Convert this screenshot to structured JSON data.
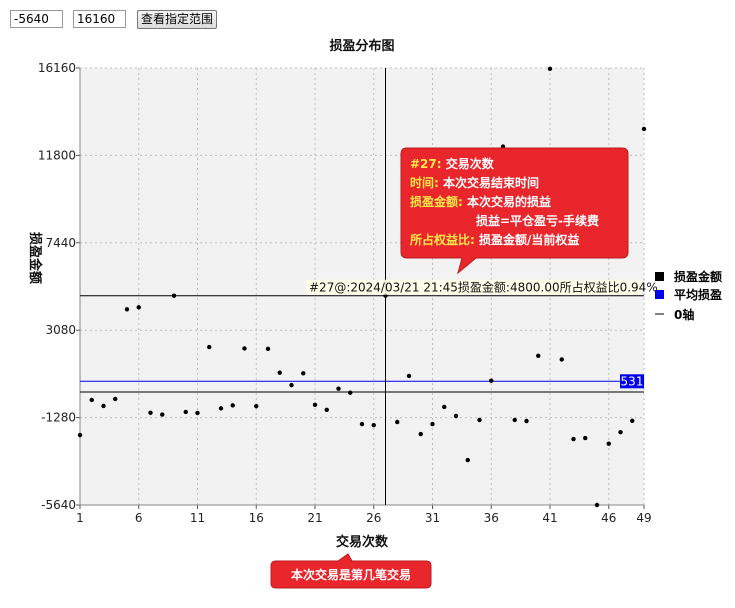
{
  "controls": {
    "min_value": "-5640",
    "max_value": "16160",
    "view_button": "查看指定范围"
  },
  "chart_data": {
    "type": "scatter",
    "title": "损盈分布图",
    "xlabel": "交易次数",
    "ylabel": "损盈金额",
    "xlim": [
      1,
      49
    ],
    "ylim": [
      -5640,
      16160
    ],
    "x_ticks": [
      1,
      6,
      11,
      16,
      21,
      26,
      31,
      36,
      41,
      46,
      49
    ],
    "y_ticks": [
      16160,
      11800,
      7440,
      3080,
      -1280,
      -5640
    ],
    "grid": true,
    "legend_position": "right",
    "series": [
      {
        "name": "损盈金额",
        "color": "#000000",
        "x": [
          1,
          2,
          3,
          4,
          5,
          6,
          7,
          8,
          9,
          10,
          11,
          12,
          13,
          14,
          15,
          16,
          17,
          18,
          19,
          20,
          21,
          22,
          23,
          24,
          25,
          26,
          27,
          28,
          29,
          30,
          31,
          32,
          33,
          34,
          35,
          36,
          37,
          38,
          39,
          40,
          41,
          42,
          43,
          44,
          45,
          46,
          47,
          48,
          49
        ],
        "y": [
          -2150,
          -400,
          -700,
          -350,
          4120,
          4220,
          -1040,
          -1130,
          4800,
          -1000,
          -1050,
          2240,
          -820,
          -670,
          2170,
          -710,
          2150,
          960,
          340,
          930,
          -640,
          -890,
          160,
          -40,
          -1600,
          -1660,
          4800,
          -1500,
          800,
          -2100,
          -1600,
          -750,
          -1200,
          -3400,
          -1400,
          560,
          12240,
          -1400,
          -1450,
          1800,
          16120,
          1620,
          -2350,
          -2300,
          -5640,
          -2580,
          -2010,
          -1440,
          13120
        ]
      },
      {
        "name": "平均损盈",
        "color": "#0000ee",
        "value": 531
      },
      {
        "name": "0轴",
        "color": "#000000",
        "value": 0
      }
    ],
    "crosshair": {
      "x": 27,
      "y": 4800
    },
    "hover_label": "#27@:2024/03/21 21:45损盈金额:4800.00所占权益比0.94%",
    "avg_label": "531"
  },
  "tooltip": {
    "lines": [
      {
        "key": "#27:",
        "text": "交易次数"
      },
      {
        "key": "时间:",
        "text": "本次交易结束时间"
      },
      {
        "key": "损盈金额:",
        "text": "本次交易的损益"
      },
      {
        "key": "",
        "text": "损益=平仓盈亏-手续费"
      },
      {
        "key": "所占权益比:",
        "text": "损盈金额/当前权益"
      }
    ]
  },
  "callout": "本次交易是第几笔交易",
  "colors": {
    "tooltip_fill": "#e8262c",
    "tooltip_key": "#ffe94a",
    "plot_bg": "#f2f2f2",
    "avg_line": "#0000ee"
  }
}
